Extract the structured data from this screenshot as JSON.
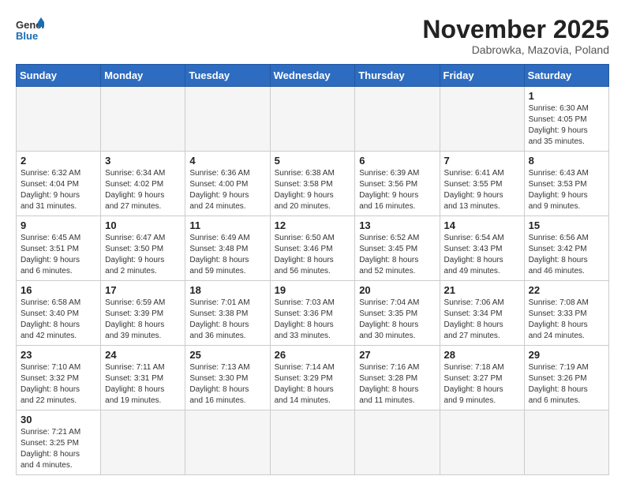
{
  "header": {
    "logo_line1": "General",
    "logo_line2": "Blue",
    "month_title": "November 2025",
    "subtitle": "Dabrowka, Mazovia, Poland"
  },
  "weekdays": [
    "Sunday",
    "Monday",
    "Tuesday",
    "Wednesday",
    "Thursday",
    "Friday",
    "Saturday"
  ],
  "weeks": [
    [
      {
        "day": "",
        "info": ""
      },
      {
        "day": "",
        "info": ""
      },
      {
        "day": "",
        "info": ""
      },
      {
        "day": "",
        "info": ""
      },
      {
        "day": "",
        "info": ""
      },
      {
        "day": "",
        "info": ""
      },
      {
        "day": "1",
        "info": "Sunrise: 6:30 AM\nSunset: 4:05 PM\nDaylight: 9 hours\nand 35 minutes."
      }
    ],
    [
      {
        "day": "2",
        "info": "Sunrise: 6:32 AM\nSunset: 4:04 PM\nDaylight: 9 hours\nand 31 minutes."
      },
      {
        "day": "3",
        "info": "Sunrise: 6:34 AM\nSunset: 4:02 PM\nDaylight: 9 hours\nand 27 minutes."
      },
      {
        "day": "4",
        "info": "Sunrise: 6:36 AM\nSunset: 4:00 PM\nDaylight: 9 hours\nand 24 minutes."
      },
      {
        "day": "5",
        "info": "Sunrise: 6:38 AM\nSunset: 3:58 PM\nDaylight: 9 hours\nand 20 minutes."
      },
      {
        "day": "6",
        "info": "Sunrise: 6:39 AM\nSunset: 3:56 PM\nDaylight: 9 hours\nand 16 minutes."
      },
      {
        "day": "7",
        "info": "Sunrise: 6:41 AM\nSunset: 3:55 PM\nDaylight: 9 hours\nand 13 minutes."
      },
      {
        "day": "8",
        "info": "Sunrise: 6:43 AM\nSunset: 3:53 PM\nDaylight: 9 hours\nand 9 minutes."
      }
    ],
    [
      {
        "day": "9",
        "info": "Sunrise: 6:45 AM\nSunset: 3:51 PM\nDaylight: 9 hours\nand 6 minutes."
      },
      {
        "day": "10",
        "info": "Sunrise: 6:47 AM\nSunset: 3:50 PM\nDaylight: 9 hours\nand 2 minutes."
      },
      {
        "day": "11",
        "info": "Sunrise: 6:49 AM\nSunset: 3:48 PM\nDaylight: 8 hours\nand 59 minutes."
      },
      {
        "day": "12",
        "info": "Sunrise: 6:50 AM\nSunset: 3:46 PM\nDaylight: 8 hours\nand 56 minutes."
      },
      {
        "day": "13",
        "info": "Sunrise: 6:52 AM\nSunset: 3:45 PM\nDaylight: 8 hours\nand 52 minutes."
      },
      {
        "day": "14",
        "info": "Sunrise: 6:54 AM\nSunset: 3:43 PM\nDaylight: 8 hours\nand 49 minutes."
      },
      {
        "day": "15",
        "info": "Sunrise: 6:56 AM\nSunset: 3:42 PM\nDaylight: 8 hours\nand 46 minutes."
      }
    ],
    [
      {
        "day": "16",
        "info": "Sunrise: 6:58 AM\nSunset: 3:40 PM\nDaylight: 8 hours\nand 42 minutes."
      },
      {
        "day": "17",
        "info": "Sunrise: 6:59 AM\nSunset: 3:39 PM\nDaylight: 8 hours\nand 39 minutes."
      },
      {
        "day": "18",
        "info": "Sunrise: 7:01 AM\nSunset: 3:38 PM\nDaylight: 8 hours\nand 36 minutes."
      },
      {
        "day": "19",
        "info": "Sunrise: 7:03 AM\nSunset: 3:36 PM\nDaylight: 8 hours\nand 33 minutes."
      },
      {
        "day": "20",
        "info": "Sunrise: 7:04 AM\nSunset: 3:35 PM\nDaylight: 8 hours\nand 30 minutes."
      },
      {
        "day": "21",
        "info": "Sunrise: 7:06 AM\nSunset: 3:34 PM\nDaylight: 8 hours\nand 27 minutes."
      },
      {
        "day": "22",
        "info": "Sunrise: 7:08 AM\nSunset: 3:33 PM\nDaylight: 8 hours\nand 24 minutes."
      }
    ],
    [
      {
        "day": "23",
        "info": "Sunrise: 7:10 AM\nSunset: 3:32 PM\nDaylight: 8 hours\nand 22 minutes."
      },
      {
        "day": "24",
        "info": "Sunrise: 7:11 AM\nSunset: 3:31 PM\nDaylight: 8 hours\nand 19 minutes."
      },
      {
        "day": "25",
        "info": "Sunrise: 7:13 AM\nSunset: 3:30 PM\nDaylight: 8 hours\nand 16 minutes."
      },
      {
        "day": "26",
        "info": "Sunrise: 7:14 AM\nSunset: 3:29 PM\nDaylight: 8 hours\nand 14 minutes."
      },
      {
        "day": "27",
        "info": "Sunrise: 7:16 AM\nSunset: 3:28 PM\nDaylight: 8 hours\nand 11 minutes."
      },
      {
        "day": "28",
        "info": "Sunrise: 7:18 AM\nSunset: 3:27 PM\nDaylight: 8 hours\nand 9 minutes."
      },
      {
        "day": "29",
        "info": "Sunrise: 7:19 AM\nSunset: 3:26 PM\nDaylight: 8 hours\nand 6 minutes."
      }
    ],
    [
      {
        "day": "30",
        "info": "Sunrise: 7:21 AM\nSunset: 3:25 PM\nDaylight: 8 hours\nand 4 minutes."
      },
      {
        "day": "",
        "info": ""
      },
      {
        "day": "",
        "info": ""
      },
      {
        "day": "",
        "info": ""
      },
      {
        "day": "",
        "info": ""
      },
      {
        "day": "",
        "info": ""
      },
      {
        "day": "",
        "info": ""
      }
    ]
  ]
}
